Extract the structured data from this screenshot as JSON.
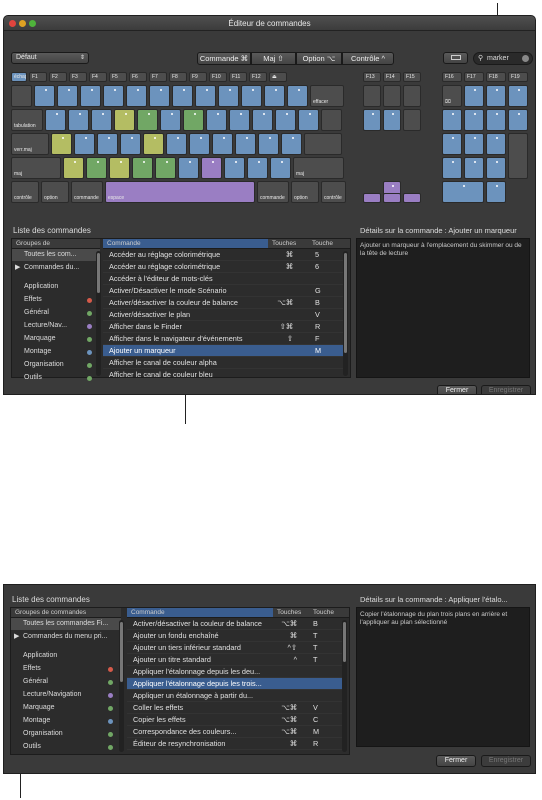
{
  "window1": {
    "title": "Éditeur de commandes",
    "preset": "Défaut",
    "modifiers": [
      "Commande ⌘",
      "Maj ⇧",
      "Option ⌥",
      "Contrôle ^"
    ],
    "search_value": "marker",
    "keyboard": {
      "fn_row": [
        "échap",
        "F1",
        "F2",
        "F3",
        "F4",
        "F5",
        "F6",
        "F7",
        "F8",
        "F9",
        "F10",
        "F11",
        "F12",
        "⏏",
        "F13",
        "F14",
        "F15",
        "F16",
        "F17",
        "F18",
        "F19"
      ],
      "labels": {
        "backspace": "effacer",
        "tab": "tabulation",
        "caps": "verr.maj",
        "shift_left": "maj",
        "shift_right": "maj",
        "ctrl_left": "contrôle",
        "option_left": "option",
        "cmd_left": "commande",
        "space": "espace",
        "cmd_right": "commande",
        "option_right": "option",
        "ctrl_right": "contrôle",
        "clear": "⌧"
      }
    },
    "command_list": {
      "section_title": "Liste des commandes",
      "groups_header": "Groupes de",
      "groups": [
        {
          "label": "Toutes les com..."
        },
        {
          "label": "Commandes du..."
        },
        {
          "label": "Application"
        },
        {
          "label": "Effets",
          "color": "#d55a4a"
        },
        {
          "label": "Général",
          "color": "#71a765"
        },
        {
          "label": "Lecture/Nav...",
          "color": "#9a7ec3"
        },
        {
          "label": "Marquage",
          "color": "#71a765"
        },
        {
          "label": "Montage",
          "color": "#6c93bd"
        },
        {
          "label": "Organisation",
          "color": "#71a765"
        },
        {
          "label": "Outils",
          "color": "#71a765"
        }
      ],
      "col_command": "Commande",
      "col_modifiers": "Touches",
      "col_key": "Touche",
      "rows": [
        {
          "cmd": "Accéder au réglage colorimétrique",
          "mod": "⌘",
          "key": "5"
        },
        {
          "cmd": "Accéder au réglage colorimétrique",
          "mod": "⌘",
          "key": "6"
        },
        {
          "cmd": "Accéder à l'éditeur de mots-clés",
          "mod": "",
          "key": ""
        },
        {
          "cmd": "Activer/Désactiver le mode Scénario",
          "mod": "",
          "key": "G"
        },
        {
          "cmd": "Activer/désactiver la couleur de balance",
          "mod": "⌥⌘",
          "key": "B"
        },
        {
          "cmd": "Activer/désactiver le plan",
          "mod": "",
          "key": "V"
        },
        {
          "cmd": "Afficher dans le Finder",
          "mod": "⇧⌘",
          "key": "R"
        },
        {
          "cmd": "Afficher dans le navigateur d'événements",
          "mod": "⇧",
          "key": "F"
        },
        {
          "cmd": "Ajouter un marqueur",
          "mod": "",
          "key": "M",
          "selected": true
        },
        {
          "cmd": "Afficher le canal de couleur alpha",
          "mod": "",
          "key": ""
        },
        {
          "cmd": "Afficher le canal de couleur bleu",
          "mod": "",
          "key": ""
        }
      ]
    },
    "details": {
      "title": "Détails sur la commande : Ajouter un marqueur",
      "text": "Ajouter un marqueur à l'emplacement du skimmer ou de la tête de lecture"
    },
    "close_label": "Fermer",
    "save_label": "Enregistrer"
  },
  "window2": {
    "section_title": "Liste des commandes",
    "groups_header": "Groupes de commandes",
    "groups": [
      {
        "label": "Toutes les commandes Fi..."
      },
      {
        "label": "Commandes du menu pri..."
      },
      {
        "label": "Application"
      },
      {
        "label": "Effets",
        "color": "#d55a4a"
      },
      {
        "label": "Général",
        "color": "#71a765"
      },
      {
        "label": "Lecture/Navigation",
        "color": "#9a7ec3"
      },
      {
        "label": "Marquage",
        "color": "#71a765"
      },
      {
        "label": "Montage",
        "color": "#6c93bd"
      },
      {
        "label": "Organisation",
        "color": "#71a765"
      },
      {
        "label": "Outils",
        "color": "#71a765"
      }
    ],
    "col_command": "Commande",
    "col_modifiers": "Touches",
    "col_key": "Touche",
    "rows": [
      {
        "cmd": "Activer/désactiver la couleur de balance",
        "mod": "⌥⌘",
        "key": "B"
      },
      {
        "cmd": "Ajouter un fondu enchaîné",
        "mod": "⌘",
        "key": "T"
      },
      {
        "cmd": "Ajouter un tiers inférieur standard",
        "mod": "^⇧",
        "key": "T"
      },
      {
        "cmd": "Ajouter un titre standard",
        "mod": "^",
        "key": "T"
      },
      {
        "cmd": "Appliquer l'étalonnage depuis les deu...",
        "mod": "",
        "key": ""
      },
      {
        "cmd": "Appliquer l'étalonnage depuis les trois...",
        "mod": "",
        "key": "",
        "selected": true
      },
      {
        "cmd": "Appliquer un étalonnage à partir du...",
        "mod": "",
        "key": ""
      },
      {
        "cmd": "Coller les effets",
        "mod": "⌥⌘",
        "key": "V"
      },
      {
        "cmd": "Copier les effets",
        "mod": "⌥⌘",
        "key": "C"
      },
      {
        "cmd": "Correspondance des couleurs...",
        "mod": "⌥⌘",
        "key": "M"
      },
      {
        "cmd": "Éditeur de resynchronisation",
        "mod": "⌘",
        "key": "R"
      }
    ],
    "details": {
      "title": "Détails sur la commande : Appliquer l'étalo...",
      "text": "Copier l'étalonnage du plan trois plans en arrière et l'appliquer au plan sélectionné"
    },
    "close_label": "Fermer",
    "save_label": "Enregistrer"
  }
}
